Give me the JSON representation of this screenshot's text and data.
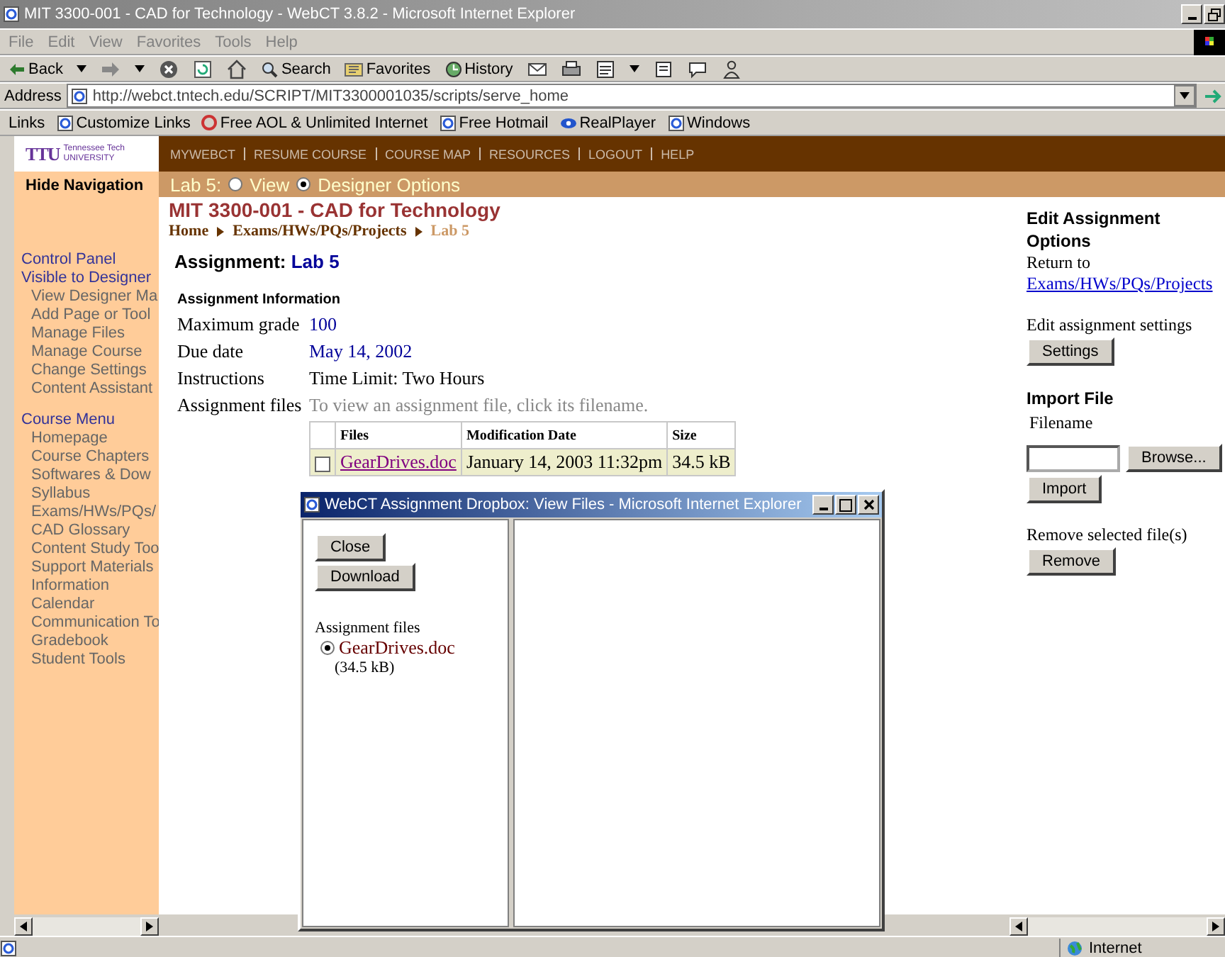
{
  "window": {
    "title": "MIT 3300-001 - CAD for Technology - WebCT 3.8.2 - Microsoft Internet Explorer"
  },
  "menu_bar": [
    "File",
    "Edit",
    "View",
    "Favorites",
    "Tools",
    "Help"
  ],
  "toolbar": [
    "Back",
    "Search",
    "Favorites",
    "History"
  ],
  "address": {
    "label": "Address",
    "value": "http://webct.tntech.edu/SCRIPT/MIT3300001035/scripts/serve_home"
  },
  "links_bar": {
    "label": "Links",
    "items": [
      "Customize Links",
      "Free AOL & Unlimited Internet",
      "Free Hotmail",
      "RealPlayer",
      "Windows"
    ]
  },
  "logo": {
    "mark": "TTU",
    "line1": "Tennessee Tech",
    "line2": "UNIVERSITY"
  },
  "top_nav": [
    "MYWEBCT",
    "RESUME COURSE",
    "COURSE MAP",
    "RESOURCES",
    "LOGOUT",
    "HELP"
  ],
  "hide_navigation": "Hide Navigation",
  "view_bar": {
    "label": "Lab 5:",
    "options": [
      {
        "label": "View",
        "selected": false
      },
      {
        "label": "Designer Options",
        "selected": true
      }
    ]
  },
  "sidebar": {
    "items": [
      {
        "label": "Control Panel"
      },
      {
        "label": "Visible to Designer",
        "children": [
          {
            "label": "View Designer Ma"
          },
          {
            "label": "Add Page or Tool"
          },
          {
            "label": "Manage Files"
          },
          {
            "label": "Manage Course"
          },
          {
            "label": "Change Settings"
          },
          {
            "label": "Content Assistant"
          }
        ]
      },
      {
        "label": "Course Menu",
        "children": [
          {
            "label": "Homepage"
          },
          {
            "label": "Course Chapters"
          },
          {
            "label": "Softwares & Dow"
          },
          {
            "label": "Syllabus"
          },
          {
            "label": "Exams/HWs/PQs/"
          },
          {
            "label": "CAD Glossary"
          },
          {
            "label": "Content Study Too"
          },
          {
            "label": "Support Materials"
          },
          {
            "label": "Information"
          },
          {
            "label": "Calendar"
          },
          {
            "label": "Communication To"
          },
          {
            "label": "Gradebook"
          },
          {
            "label": "Student Tools"
          }
        ]
      }
    ]
  },
  "course_title": "MIT 3300-001 - CAD for Technology",
  "breadcrumb": [
    {
      "label": "Home",
      "current": false
    },
    {
      "label": "Exams/HWs/PQs/Projects",
      "current": false
    },
    {
      "label": "Lab 5",
      "current": true
    }
  ],
  "assignment": {
    "label": "Assignment:",
    "name": "Lab 5",
    "section": "Assignment Information",
    "fields": [
      {
        "label": "Maximum grade",
        "value": "100",
        "kind": "link"
      },
      {
        "label": "Due date",
        "value": "May 14, 2002",
        "kind": "link"
      },
      {
        "label": "Instructions",
        "value": "Time Limit: Two Hours",
        "kind": "plain"
      },
      {
        "label": "Assignment files",
        "value": "To view an assignment file, click its filename.",
        "kind": "hint"
      }
    ]
  },
  "files_table": {
    "columns": [
      "Files",
      "Modification Date",
      "Size"
    ],
    "rows": [
      {
        "checked": false,
        "file": "GearDrives.doc",
        "date": "January 14, 2003 11:32pm",
        "size": "34.5 kB"
      }
    ]
  },
  "right_panel": {
    "title": "Edit Assignment Options",
    "return_label": "Return to",
    "return_link": "Exams/HWs/PQs/Projects",
    "settings_label": "Edit assignment settings",
    "settings_button": "Settings",
    "import_title": "Import File",
    "filename_label": "Filename",
    "browse_button": "Browse...",
    "import_button": "Import",
    "remove_label": "Remove selected file(s)",
    "remove_button": "Remove"
  },
  "popup": {
    "title": "WebCT Assignment Dropbox: View Files - Microsoft Internet Explorer",
    "buttons": [
      "Close",
      "Download"
    ],
    "files_label": "Assignment files",
    "files": [
      {
        "name": "GearDrives.doc",
        "size": "(34.5 kB)",
        "selected": true
      }
    ]
  },
  "status_bar": {
    "zone": "Internet"
  }
}
